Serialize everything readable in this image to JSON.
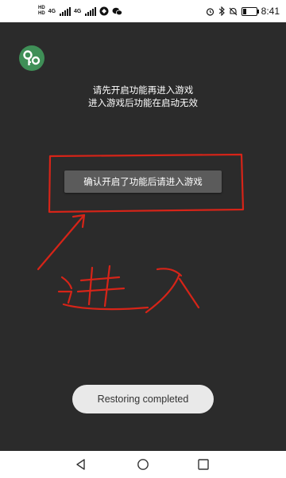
{
  "status_bar": {
    "hd_top": "HD",
    "hd_bottom": "HD",
    "network_1": "4G",
    "network_2": "4G",
    "time": "8:41",
    "battery_level": 0.25
  },
  "app": {
    "message_line1": "请先开启功能再进入游戏",
    "message_line2": "进入游戏后功能在启动无效",
    "confirm_button": "确认开启了功能后请进入游戏"
  },
  "annotation": {
    "handwritten_text": "进入",
    "color": "#d62418"
  },
  "toast": {
    "text": "Restoring completed"
  },
  "colors": {
    "background": "#2b2b2b",
    "logo": "#3f8f57",
    "button": "#5b5b5b",
    "toast": "#e9e9e9"
  }
}
